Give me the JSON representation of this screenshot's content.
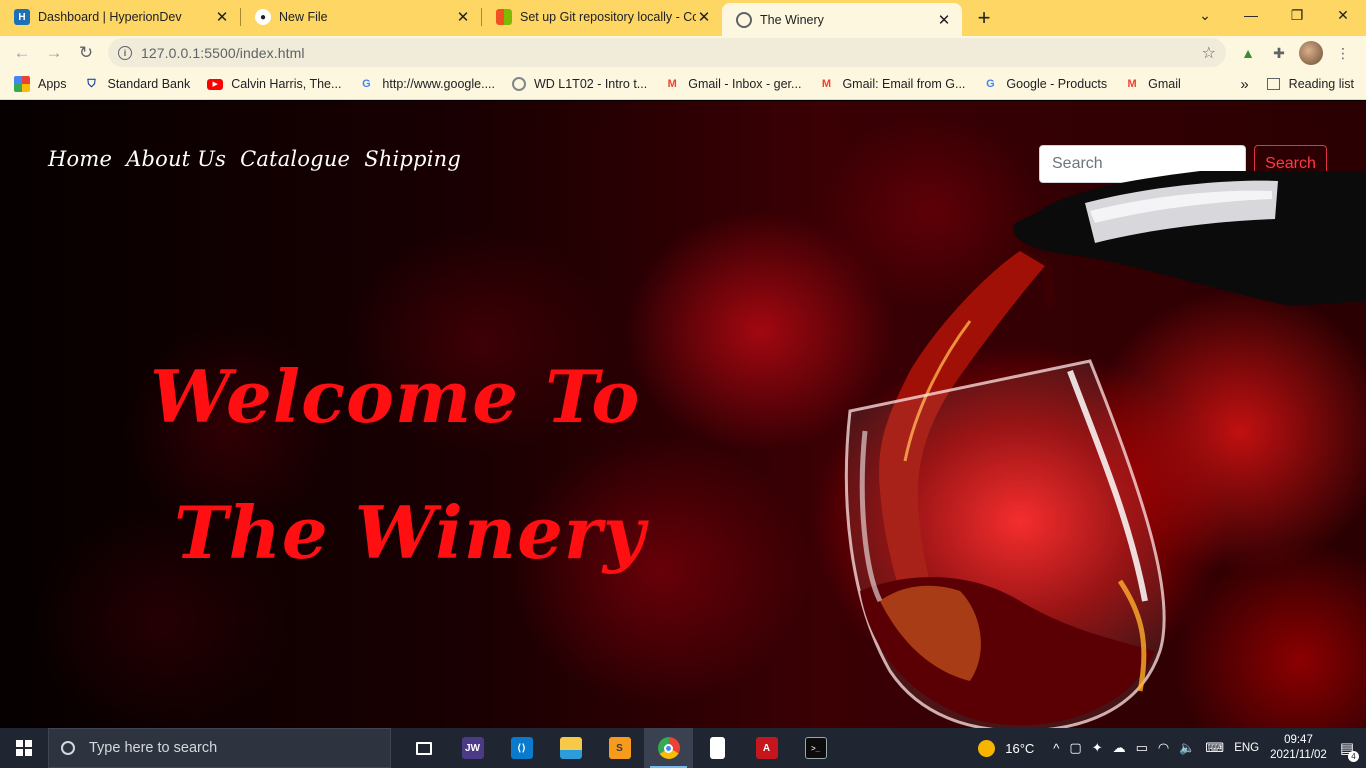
{
  "browser": {
    "tabs": [
      {
        "title": "Dashboard | HyperionDev",
        "active": false,
        "icon": "hyperiondev-icon"
      },
      {
        "title": "New File",
        "active": false,
        "icon": "github-icon"
      },
      {
        "title": "Set up Git repository locally - Co",
        "active": false,
        "icon": "microsoft-icon"
      },
      {
        "title": "The Winery",
        "active": true,
        "icon": "globe-icon"
      }
    ],
    "close_glyph": "✕",
    "new_tab_glyph": "+",
    "url": "127.0.0.1:5500/index.html",
    "bookmarks": [
      {
        "label": "Apps",
        "icon": "apps-grid-icon"
      },
      {
        "label": "Standard Bank",
        "icon": "shield-icon"
      },
      {
        "label": "Calvin Harris, The...",
        "icon": "youtube-icon"
      },
      {
        "label": "http://www.google....",
        "icon": "google-icon"
      },
      {
        "label": "WD L1T02 - Intro t...",
        "icon": "globe-icon"
      },
      {
        "label": "Gmail - Inbox - ger...",
        "icon": "gmail-icon"
      },
      {
        "label": "Gmail: Email from G...",
        "icon": "gmail-icon"
      },
      {
        "label": "Google - Products",
        "icon": "google-icon"
      },
      {
        "label": "Gmail",
        "icon": "gmail-icon"
      }
    ],
    "overflow_glyph": "»",
    "reading_list": "Reading list"
  },
  "site": {
    "nav": [
      "Home",
      "About Us",
      "Catalogue",
      "Shipping"
    ],
    "search_placeholder": "Search",
    "search_button": "Search",
    "hero_line1": "Welcome To",
    "hero_line2": "The Winery"
  },
  "taskbar": {
    "search_placeholder": "Type here to search",
    "apps": [
      "task-view-icon",
      "jw-player-icon",
      "vscode-icon",
      "file-explorer-icon",
      "sublime-text-icon",
      "chrome-icon",
      "file-icon",
      "acrobat-icon",
      "terminal-icon"
    ],
    "jw_label": "JW",
    "weather": "16°C",
    "language": "ENG",
    "time": "09:47",
    "date": "2021/11/02",
    "notifications": "4"
  },
  "colors": {
    "tabstrip": "#fdd663",
    "toolbar": "#fef7e0",
    "hero_text": "#ff0f12",
    "search_button": "#dc3545",
    "taskbar": "#1f2632"
  }
}
